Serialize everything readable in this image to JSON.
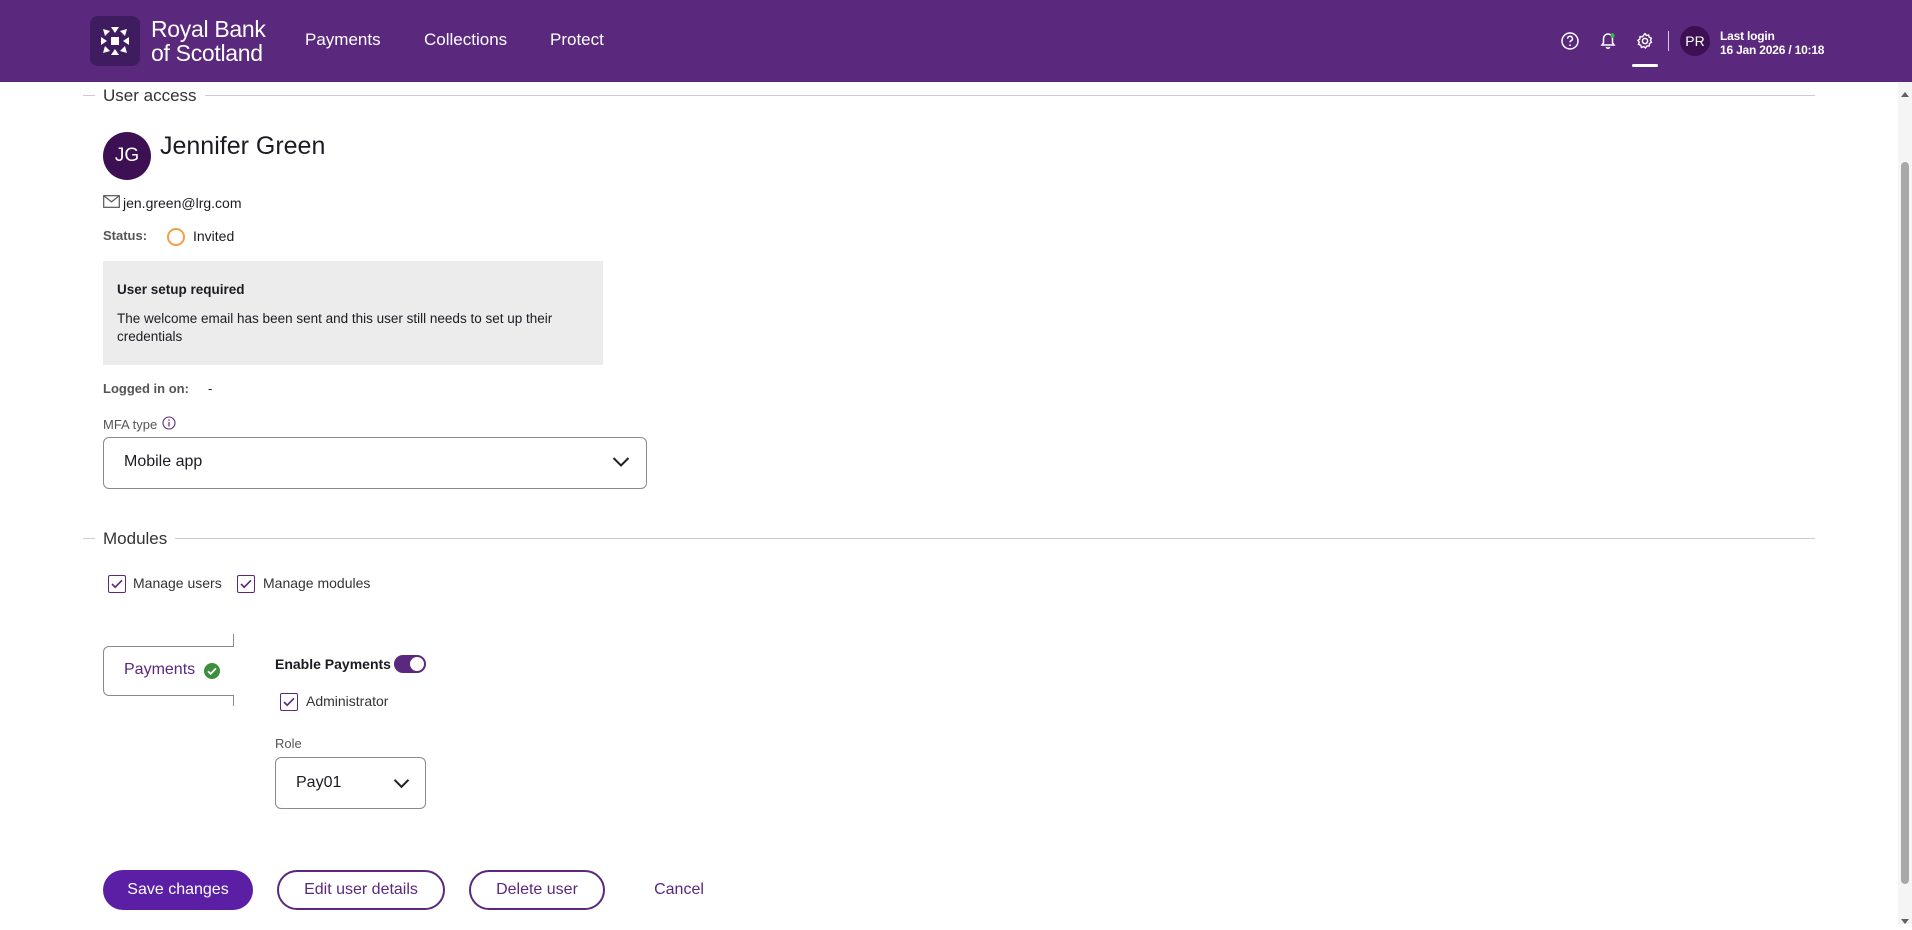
{
  "header": {
    "brand_line1": "Royal Bank",
    "brand_line2": "of Scotland",
    "nav": [
      "Payments",
      "Collections",
      "Protect"
    ],
    "avatar_initials": "PR",
    "last_login_label": "Last login",
    "last_login_value": "16 Jan 2026 / 10:18"
  },
  "user_access": {
    "section_title": "User access",
    "initials": "JG",
    "name": "Jennifer Green",
    "email": "jen.green@lrg.com",
    "status_label": "Status:",
    "status_value": "Invited",
    "notice_title": "User setup required",
    "notice_body": "The welcome email has been sent and this user still needs to set up their credentials",
    "logged_in_label": "Logged in on:",
    "logged_in_value": "-",
    "mfa_label": "MFA type",
    "mfa_value": "Mobile app"
  },
  "modules": {
    "section_title": "Modules",
    "manage_users": "Manage users",
    "manage_modules": "Manage modules",
    "tab_label": "Payments",
    "enable_label": "Enable Payments",
    "enabled": true,
    "administrator": "Administrator",
    "role_label": "Role",
    "role_value": "Pay01"
  },
  "actions": {
    "save": "Save changes",
    "edit": "Edit user details",
    "delete": "Delete user",
    "cancel": "Cancel"
  },
  "colors": {
    "brand_purple": "#5a287d",
    "primary_button": "#5a1fa5",
    "status_invited": "#f0a04b",
    "success_green": "#3c8f3c"
  }
}
